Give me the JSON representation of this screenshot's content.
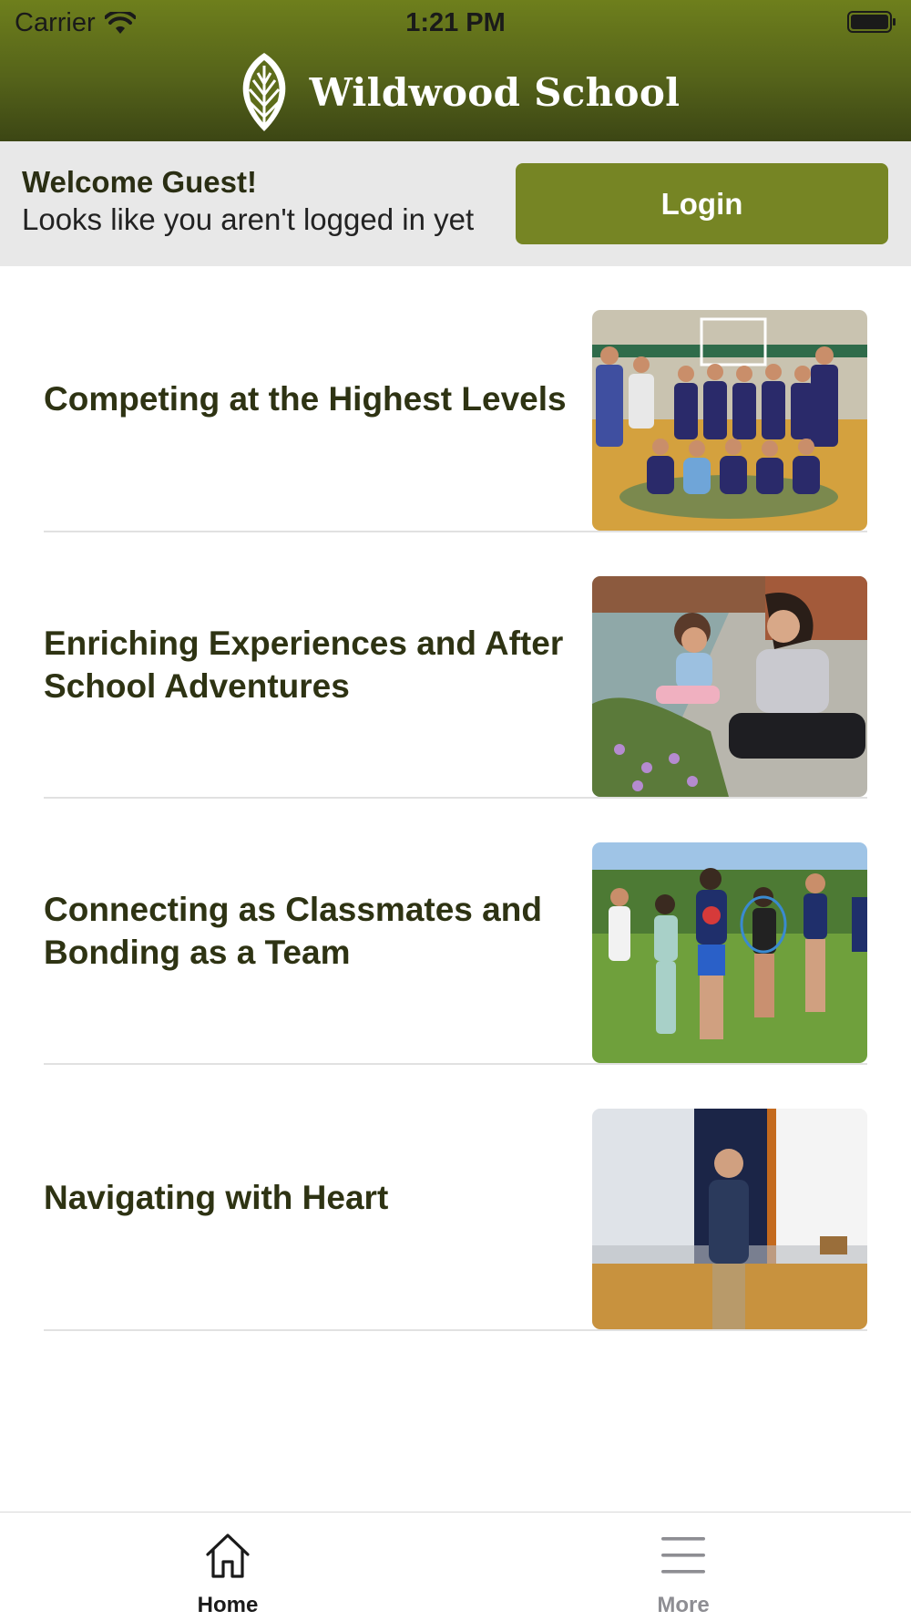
{
  "status_bar": {
    "carrier": "Carrier",
    "time": "1:21 PM",
    "wifi_icon": "wifi-icon",
    "battery_icon": "battery-icon"
  },
  "header": {
    "logo_icon": "leaf-logo-icon",
    "school_name": "Wildwood School"
  },
  "welcome": {
    "title": "Welcome Guest!",
    "subtitle": "Looks like you aren't logged in yet",
    "login_label": "Login"
  },
  "feed": {
    "items": [
      {
        "title": "Competing at the Highest Levels",
        "image": "volleyball-team-photo"
      },
      {
        "title": "Enriching Experiences and After School Adventures",
        "image": "garden-activity-photo"
      },
      {
        "title": "Connecting as Classmates and Bonding as a Team",
        "image": "students-holding-hands-photo"
      },
      {
        "title": "Navigating with Heart",
        "image": "speaker-on-stage-photo"
      }
    ]
  },
  "tabbar": {
    "tabs": [
      {
        "label": "Home",
        "icon": "home-icon",
        "selected": true
      },
      {
        "label": "More",
        "icon": "menu-icon",
        "selected": false
      }
    ]
  },
  "colors": {
    "header_green": "#6e7f1c",
    "button_green": "#768524",
    "title_text": "#2e3313",
    "welcome_bg": "#e8e8e8"
  }
}
